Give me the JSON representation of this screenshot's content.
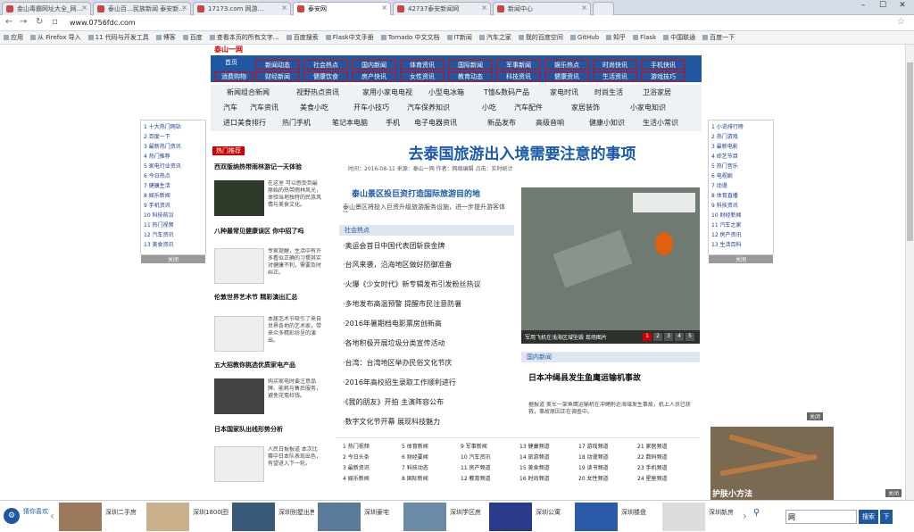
{
  "browser": {
    "tabs": [
      "金山毒霸网址大全_网…",
      "泰山百…民族新闻 泰安新…",
      "17173.com 网游…",
      "泰安网",
      "42737泰安新闻网",
      "新闻中心"
    ],
    "window_controls": [
      "–",
      "☐",
      "✕"
    ],
    "url": "www.0756fdc.com",
    "bookmarks": [
      "应用",
      "从 Firefox 导入",
      "11 代码与开发工具",
      "博客",
      "百度",
      "查看本页的所有文字…",
      "百度搜索",
      "Flask中文手册",
      "Tornado 中文文档",
      "IT新闻",
      "汽车之家",
      "我的百度空间",
      "GitHub",
      "知乎",
      "Flask",
      "中国联通",
      "百度一下"
    ]
  },
  "site": {
    "logo": "泰山一网",
    "nav_home": "首页",
    "nav_row1": [
      "新闻动态",
      "社会热点",
      "国内新闻",
      "体育资讯",
      "国际新闻",
      "军事新闻",
      "娱乐热点",
      "时尚快讯",
      "手机快讯"
    ],
    "nav_row2": [
      "消费购物",
      "财经新闻",
      "健康饮食",
      "房产快讯",
      "女性资讯",
      "教育动态",
      "科技资讯",
      "健康资讯",
      "生活资讯",
      "游戏技巧"
    ],
    "subnav": [
      [
        "新闻组合新闻",
        "视野热点资讯",
        "家用小家电电视",
        "小型电冰箱",
        "T恤&数码产品",
        "家电时讯",
        "时尚生活",
        "卫浴家居"
      ],
      [
        "汽车",
        "汽车资讯",
        "美食小吃",
        "开车小技巧",
        "汽车保养知识",
        "小吃",
        "汽车配件",
        "家居装饰",
        "小家电知识"
      ],
      [
        "进口美食排行",
        "热门手机",
        "笔记本电脑",
        "手机",
        "电子电器资讯",
        "新品发布",
        "高级音响",
        "健康小知识",
        "生活小常识"
      ]
    ],
    "left_side_list": [
      "1 十大热门网站",
      "2 百度一下",
      "3 最新热门资讯",
      "4 热门推荐",
      "5 家电行业资讯",
      "6 今日热点",
      "7 健康生活",
      "8 娱乐新闻",
      "9 手机资讯",
      "10 科技前沿",
      "11 热门视频",
      "12 汽车资讯",
      "13 美食资讯"
    ],
    "right_side_list": [
      "1 小说排行榜",
      "2 热门游戏",
      "3 最新电影",
      "4 综艺节目",
      "5 热门音乐",
      "6 电视剧",
      "7 动漫",
      "8 体育直播",
      "9 科技资讯",
      "10 财经新闻",
      "11 汽车之家",
      "12 房产资讯",
      "13 生活百科"
    ],
    "side_close": "关闭",
    "left_section_tag": "热门推荐",
    "left_news": [
      {
        "title": "西双版纳热带雨林游记一天体验",
        "desc": "在这里 可以感受到最原始的热带雨林风光，体验当地独特的民族风情与美食文化。"
      },
      {
        "title": "八种最常见健康误区 你中招了吗",
        "desc": "专家提醒，生活中有许多看似正确的习惯其实对健康不利，需要及时纠正。"
      },
      {
        "title": "伦敦世界艺术节 精彩演出汇总",
        "desc": "本届艺术节吸引了来自世界各地的艺术家，带来众多精彩纷呈的演出。"
      },
      {
        "title": "五大招教你挑选优质家电产品",
        "desc": "购买家电时要注意品牌、能耗与售后服务，避免花冤枉钱。"
      },
      {
        "title": "日本国家队出线形势分析",
        "desc": "人民日报报道 本次比赛中日本队表现出色，有望进入下一轮。"
      }
    ],
    "headline": "去泰国旅游出入境需要注意的事项",
    "headline_meta": "时间：2016-08-11  来源：泰山一网  作者：网络编辑  点击：实时统计",
    "sub_headline": "泰山景区投巨资打造国际旅游目的地",
    "sub_desc": "泰山景区将投入巨资升级旅游服务设施，进一步提升游客体验。",
    "list_tag": "社会热点",
    "center_list": [
      "·奥运会首日中国代表团斩获金牌",
      "·台风来袭，沿海地区做好防御准备",
      "·火爆《少女时代》新专辑发布引发粉丝热议",
      "·多地发布高温预警 提醒市民注意防暑",
      "·2016年暑期档电影票房创新高",
      "·各地积极开展垃圾分类宣传活动",
      "·台湾：台湾地区举办民俗文化节庆",
      "·2016年高校招生录取工作顺利进行",
      "·《我的朋友》开拍 主演阵容公布",
      "·数字文化节开幕 展现科技魅力"
    ],
    "photo_caption": "军用飞机在浅海区域坠毁 现场图片",
    "photo_pager": [
      "1",
      "2",
      "3",
      "4",
      "5"
    ],
    "right_tag": "国内新闻",
    "right_headline": "日本冲绳县发生鱼鹰运输机事故",
    "right_desc": "据报道 美军一架鱼鹰运输机在冲绳附近海域发生事故，机上人员已获救，事故原因正在调查中。",
    "bottom_grid": [
      [
        "1 热门视频",
        "2 今日头条",
        "3 最新资讯",
        "4 娱乐新闻"
      ],
      [
        "5 体育新闻",
        "6 财经要闻",
        "7 科技动态",
        "8 国际新闻"
      ],
      [
        "9 军事新闻",
        "10 汽车资讯",
        "11 房产频道",
        "12 教育频道"
      ],
      [
        "13 健康频道",
        "14 旅游频道",
        "15 美食频道",
        "16 时尚频道"
      ],
      [
        "17 游戏频道",
        "18 动漫频道",
        "19 读书频道",
        "20 女性频道"
      ],
      [
        "21 家居频道",
        "22 数码频道",
        "23 手机频道",
        "24 星座频道"
      ]
    ],
    "right_ad_title": "护肤小方法",
    "right_ad_close": "关闭",
    "bottom_close": "关闭"
  },
  "adstrip": {
    "left_label": "猜你喜欢",
    "items": [
      "深圳二手房",
      "深圳1800团购",
      "深圳别墅出售",
      "深圳豪宅",
      "深圳学区房",
      "深圳公寓",
      "深圳楼盘",
      "深圳新房",
      "深圳商铺"
    ],
    "search_placeholder": "搜索",
    "search_value": "网",
    "search_btn": "搜索",
    "next_btn": "下"
  },
  "colors": {
    "nav_blue": "#1f57a0",
    "accent_red": "#cc0000",
    "headline_blue": "#1a5aa8"
  }
}
